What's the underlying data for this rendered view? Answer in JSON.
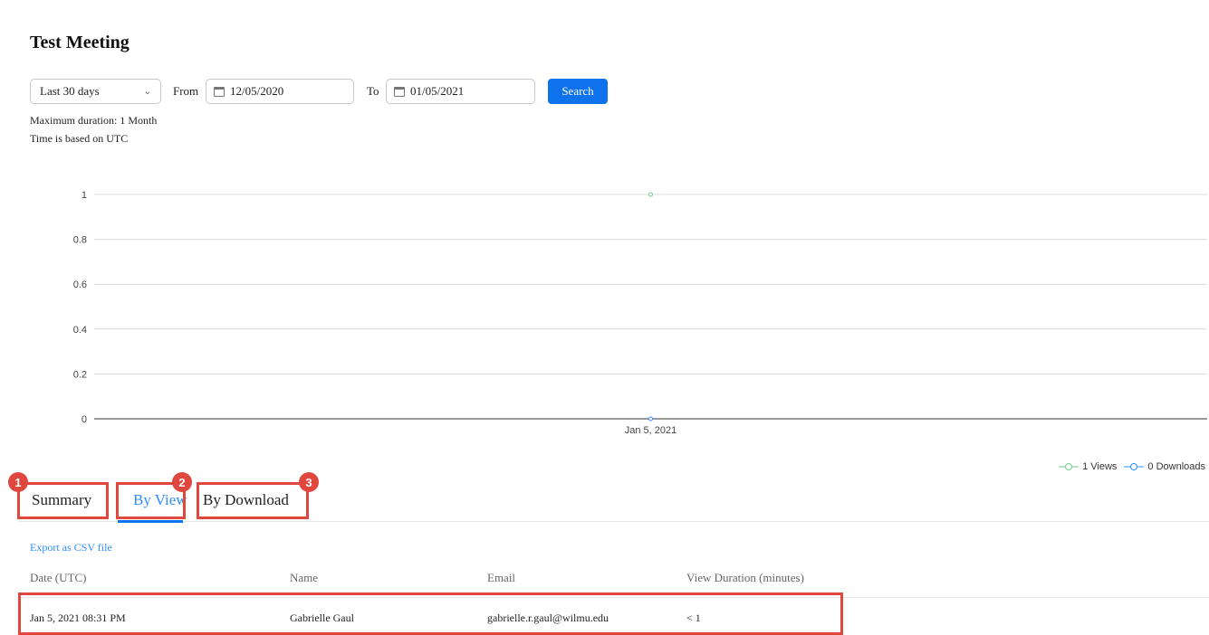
{
  "page": {
    "title": "Test Meeting"
  },
  "filters": {
    "range_select": "Last 30 days",
    "from_label": "From",
    "from_date": "12/05/2020",
    "to_label": "To",
    "to_date": "01/05/2021",
    "search_label": "Search",
    "max_duration_note": "Maximum duration: 1 Month",
    "timezone_note": "Time is based on UTC"
  },
  "chart_data": {
    "type": "line",
    "categories": [
      "Jan 5, 2021"
    ],
    "series": [
      {
        "name": "1 Views",
        "values": [
          1
        ],
        "color": "#6fcf8a"
      },
      {
        "name": "0 Downloads",
        "values": [
          0
        ],
        "color": "#2d8cff"
      }
    ],
    "ylim": [
      0,
      1
    ],
    "yticks": [
      "0",
      "0.2",
      "0.4",
      "0.6",
      "0.8",
      "1"
    ],
    "grid": true,
    "legend": "bottom-right"
  },
  "tabs": [
    {
      "label": "Summary",
      "badge": "1"
    },
    {
      "label": "By View",
      "badge": "2"
    },
    {
      "label": "By Download",
      "badge": "3"
    }
  ],
  "export_label": "Export as CSV file",
  "table": {
    "headers": [
      "Date (UTC)",
      "Name",
      "Email",
      "View Duration (minutes)"
    ],
    "rows": [
      [
        "Jan 5, 2021 08:31 PM",
        "Gabrielle Gaul",
        "gabrielle.r.gaul@wilmu.edu",
        "< 1"
      ]
    ]
  }
}
